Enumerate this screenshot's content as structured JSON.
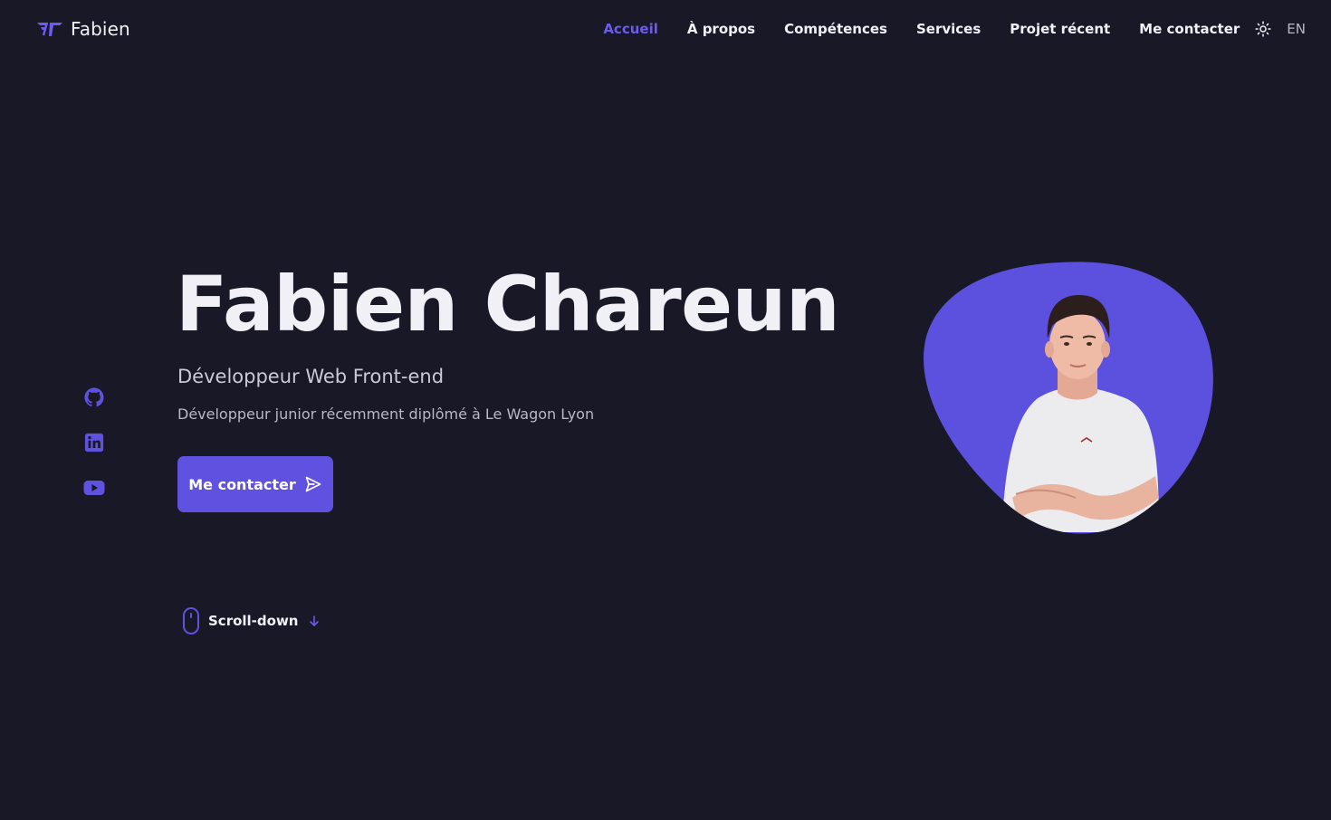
{
  "brand": {
    "name": "Fabien",
    "logo_icon": "fc-monogram-icon"
  },
  "nav": {
    "items": [
      {
        "label": "Accueil",
        "active": true
      },
      {
        "label": "À propos",
        "active": false
      },
      {
        "label": "Compétences",
        "active": false
      },
      {
        "label": "Services",
        "active": false
      },
      {
        "label": "Projet récent",
        "active": false
      },
      {
        "label": "Me contacter",
        "active": false
      }
    ],
    "theme_icon": "sun-icon",
    "language": "EN"
  },
  "socials": [
    {
      "name": "github",
      "icon": "github-icon"
    },
    {
      "name": "linkedin",
      "icon": "linkedin-icon"
    },
    {
      "name": "youtube",
      "icon": "youtube-icon"
    }
  ],
  "hero": {
    "title": "Fabien Chareun",
    "subtitle": "Développeur Web Front-end",
    "description": "Développeur junior récemment diplômé à Le Wagon Lyon",
    "cta_label": "Me contacter",
    "cta_icon": "send-icon"
  },
  "scroll": {
    "label": "Scroll-down",
    "mouse_icon": "mouse-icon",
    "arrow_icon": "arrow-down-icon"
  },
  "portrait": {
    "shape": "blob"
  },
  "colors": {
    "background": "#181827",
    "accent": "#6052e0",
    "accent_light": "#6a5cf0",
    "text": "#f1f0f6",
    "muted_text": "#b9b8c6"
  }
}
